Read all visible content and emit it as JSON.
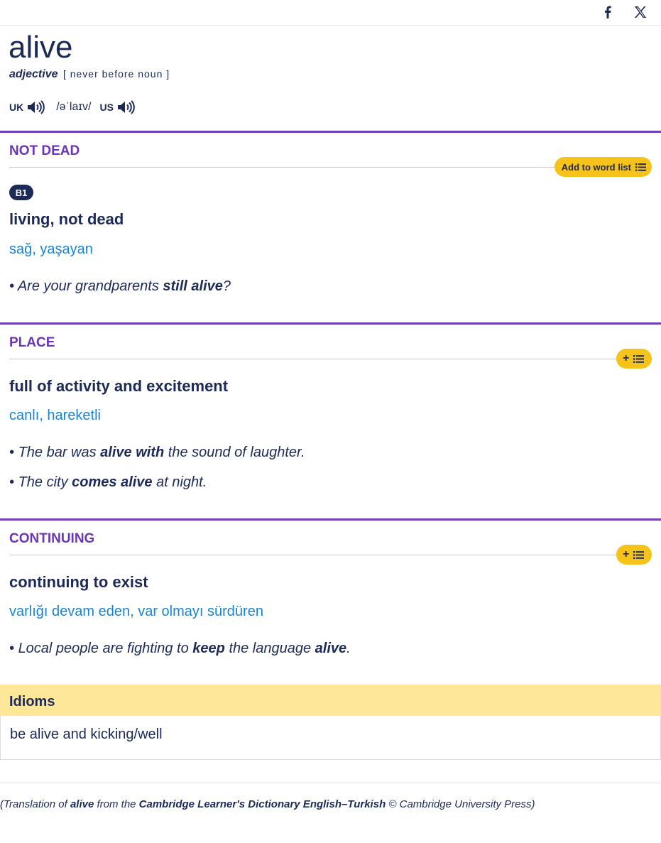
{
  "entry": {
    "headword": "alive",
    "pos": "adjective",
    "grammar": "[ never before noun ]",
    "pron": {
      "uk_label": "UK",
      "ipa": "/əˈlaɪv/",
      "us_label": "US"
    }
  },
  "share_icons": [
    "facebook-icon",
    "x-icon"
  ],
  "senses": [
    {
      "guide": "NOT DEAD",
      "wordlist_label": "Add to word list",
      "level": "B1",
      "definition": "living, not dead",
      "translation": "sağ, yaşayan",
      "examples": [
        {
          "pre": "Are your grandparents ",
          "bold": "still alive",
          "post": "?"
        }
      ]
    },
    {
      "guide": "PLACE",
      "wordlist_label": "+",
      "definition": "full of activity and excitement",
      "translation": "canlı, hareketli",
      "examples": [
        {
          "pre": "The bar was ",
          "bold": "alive with",
          "post": " the sound of laughter."
        },
        {
          "pre": "The city ",
          "bold": "comes alive",
          "post": " at night."
        }
      ]
    },
    {
      "guide": "CONTINUING",
      "wordlist_label": "+",
      "definition": "continuing to exist",
      "translation": "varlığı devam eden, var olmayı sürdüren",
      "examples": [
        {
          "pre": "Local people are fighting to ",
          "bold": "keep",
          "mid": " the language ",
          "bold2": "alive",
          "post": "."
        }
      ]
    }
  ],
  "idioms": {
    "title": "Idioms",
    "items": [
      "be alive and kicking/well"
    ]
  },
  "credit": {
    "p1": "(Translation of ",
    "word": "alive",
    "p2": " from the ",
    "dict": "Cambridge Learner's Dictionary English–Turkish",
    "p3": " © Cambridge University Press)"
  },
  "colors": {
    "navy": "#1d2a57",
    "purple": "#6b35b7",
    "link_blue": "#1a84d4",
    "yellow": "#f5c31a",
    "idiom_bg": "#ffe79a"
  }
}
